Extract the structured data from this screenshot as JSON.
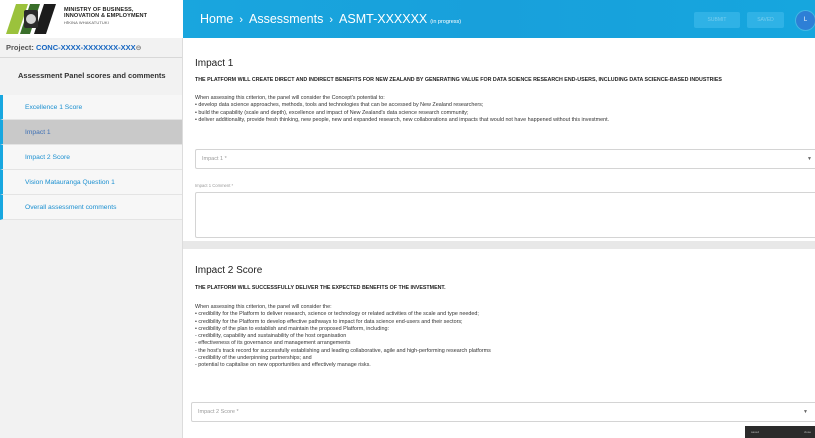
{
  "header": {
    "logo": {
      "line1": "MINISTRY OF BUSINESS,",
      "line2": "INNOVATION & EMPLOYMENT",
      "line3": "HĪKINA WHAKATUTUKI"
    },
    "breadcrumb": {
      "home": "Home",
      "assessments": "Assessments",
      "current": "ASMT-XXXXXX",
      "status": "(in progress)",
      "separator": "›"
    },
    "buttons": {
      "submit": "SUBMIT",
      "saved": "SAVED"
    },
    "avatar_initial": "L",
    "colors": {
      "header_bg": "#18a3dd",
      "avatar_bg": "#2e7fd6"
    }
  },
  "sidebar": {
    "project_label": "Project:",
    "project_code": "CONC-XXXX-XXXXXXX-XXX",
    "section_title": "Assessment Panel scores and comments",
    "items": [
      {
        "label": "Excellence 1 Score",
        "active": false
      },
      {
        "label": "Impact 1",
        "active": true
      },
      {
        "label": "Impact 2 Score",
        "active": false
      },
      {
        "label": "Vision Matauranga Question 1",
        "active": false
      },
      {
        "label": "Overall assessment comments",
        "active": false
      }
    ]
  },
  "impact1": {
    "title": "Impact 1",
    "subheading": "THE PLATFORM WILL CREATE DIRECT AND INDIRECT BENEFITS FOR NEW ZEALAND BY GENERATING VALUE FOR DATA SCIENCE RESEARCH END-USERS, INCLUDING DATA SCIENCE-BASED INDUSTRIES",
    "intro": "When assessing this criterion, the panel will consider the Concept's potential to:",
    "bullets": [
      "• develop data science approaches, methods, tools and technologies that can be accessed by New Zealand researchers;",
      "• build the capability (scale and depth), excellence and impact of New Zealand's data science research community;",
      "• deliver additionality, provide fresh thinking, new people, new and expanded research, new collaborations and impacts that would not have happened without this investment."
    ],
    "select_placeholder": "Impact 1 *",
    "comment_label": "Impact 1 Comment *"
  },
  "impact2": {
    "title": "Impact 2 Score",
    "subheading": "THE PLATFORM WILL SUCCESSFULLY DELIVER THE EXPECTED BENEFITS OF THE INVESTMENT.",
    "intro": "When assessing this criterion, the panel will consider the:",
    "bullets": [
      "• credibility for the Platform to deliver research, science or technology or related activities of the scale and type needed;",
      "• credibility for the Platform to develop effective pathways to impact for data science end-users and their sectors;",
      "• credibility of the plan to establish and maintain the proposed Platform, including:",
      "- credibility, capability and sustainability of the host organisation",
      "- effectiveness of its governance and management arrangements",
      "- the host's track record for successfully establishing and leading collaborative, agile and high-performing research platforms",
      "- credibility of the underpinning partnerships; and",
      "- potential to capitalise on new opportunities and effectively manage risks."
    ],
    "select_placeholder": "Impact 2 Score *"
  },
  "toast": {
    "left": "saved",
    "right": "close"
  }
}
